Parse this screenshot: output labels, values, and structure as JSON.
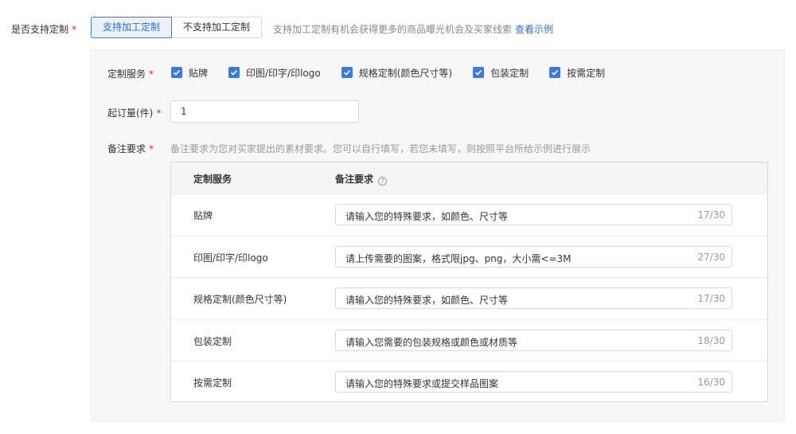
{
  "customization": {
    "label": "是否支持定制",
    "required_mark": "*",
    "options": [
      "支持加工定制",
      "不支持加工定制"
    ],
    "selected": "支持加工定制",
    "hint": "支持加工定制有机会获得更多的商品曝光机会及买家线索",
    "example_link": "查看示例"
  },
  "panel": {
    "services": {
      "label": "定制服务",
      "required_mark": "*",
      "items": [
        {
          "label": "贴牌",
          "checked": true
        },
        {
          "label": "印图/印字/印logo",
          "checked": true
        },
        {
          "label": "规格定制(颜色尺寸等)",
          "checked": true
        },
        {
          "label": "包装定制",
          "checked": true
        },
        {
          "label": "按需定制",
          "checked": true
        }
      ]
    },
    "min_order": {
      "label": "起订量(件)",
      "required_mark": "*",
      "value": "1"
    },
    "notes": {
      "label": "备注要求",
      "required_mark": "*",
      "hint": "备注要求为您对买家提出的素材要求。您可以自行填写，若您未填写，则按照平台所给示例进行展示",
      "table": {
        "col_service": "定制服务",
        "col_note": "备注要求",
        "help_icon": "question-circle-icon",
        "rows": [
          {
            "service": "贴牌",
            "note": "请输入您的特殊要求，如颜色、尺寸等",
            "count": "17/30"
          },
          {
            "service": "印图/印字/印logo",
            "note": "请上传需要的图案，格式限jpg、png，大小需<=3M",
            "count": "27/30"
          },
          {
            "service": "规格定制(颜色尺寸等)",
            "note": "请输入您的特殊要求，如颜色、尺寸等",
            "count": "17/30"
          },
          {
            "service": "包装定制",
            "note": "请输入您需要的包装规格或颜色或材质等",
            "count": "18/30"
          },
          {
            "service": "按需定制",
            "note": "请输入您的特殊要求或提交样品图案",
            "count": "16/30"
          }
        ]
      }
    }
  },
  "colors": {
    "accent": "#3d7bd9",
    "required": "#f5222d",
    "panel_bg": "#f7f7f7"
  }
}
